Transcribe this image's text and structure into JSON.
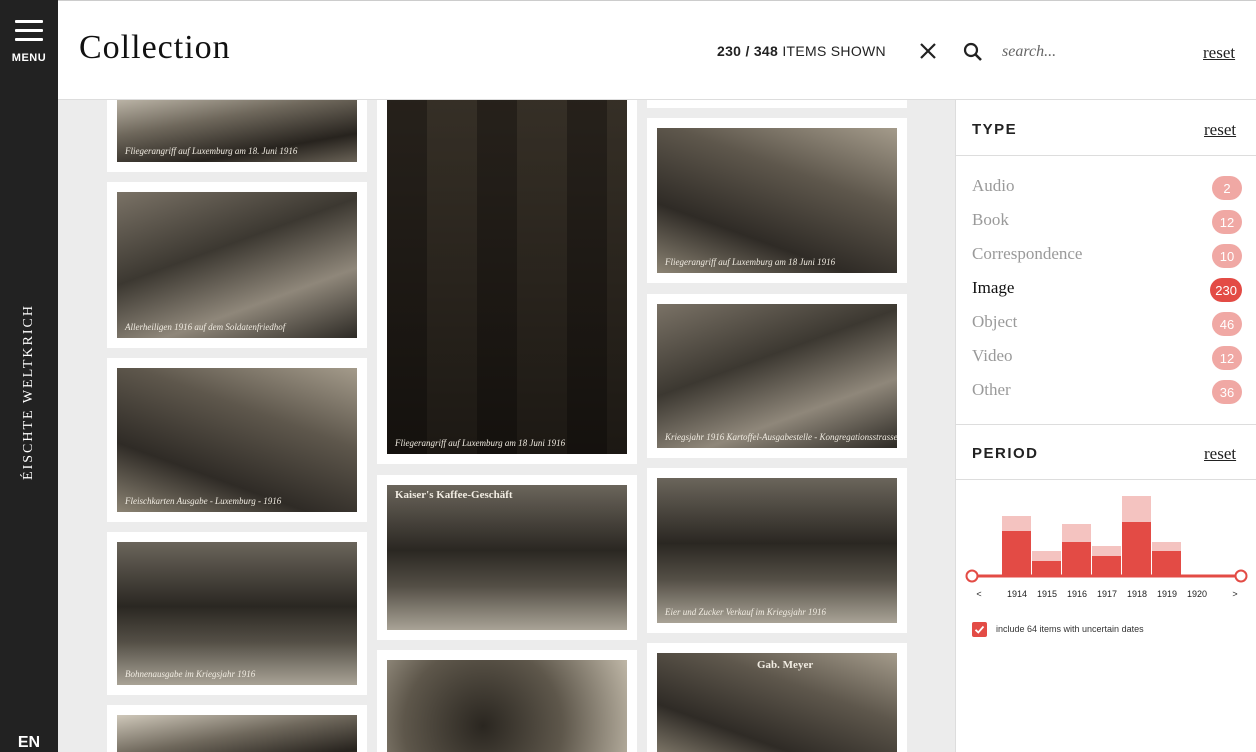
{
  "nav": {
    "menu_label": "MENU",
    "brand": "ÉISCHTE WELTKRICH",
    "language": "EN"
  },
  "header": {
    "title": "Collection",
    "shown": "230",
    "total": "348",
    "shown_suffix": "ITEMS SHOWN",
    "search_placeholder": "search...",
    "reset_label": "reset"
  },
  "gallery": {
    "captions": {
      "c1": "Fliegerangriff auf Luxemburg am 18. Juni 1916",
      "c2": "Allerheiligen 1916 auf dem Soldatenfriedhof",
      "c3": "Fleischkarten Ausgabe - Luxemburg - 1916",
      "c4": "Bohnenausgabe im Kriegsjahr 1916",
      "c5": "Fliegerangriff auf Luxemburg am 18 Juni 1916",
      "c6": "Kaiser's Kaffee-Geschäft",
      "c7": "Fliegerangriff auf Luxemburg am 18 Juni 1916",
      "c8": "Kriegsjahr 1916 Kartoffel-Ausgabestelle - Kongregationsstrasse",
      "c9": "Eier und Zucker Verkauf im Kriegsjahr 1916",
      "c10": "Gab. Meyer"
    }
  },
  "filters": {
    "type": {
      "title": "TYPE",
      "reset_label": "reset",
      "items": [
        {
          "label": "Audio",
          "count": "2",
          "active": false
        },
        {
          "label": "Book",
          "count": "12",
          "active": false
        },
        {
          "label": "Correspondence",
          "count": "10",
          "active": false
        },
        {
          "label": "Image",
          "count": "230",
          "active": true
        },
        {
          "label": "Object",
          "count": "46",
          "active": false
        },
        {
          "label": "Video",
          "count": "12",
          "active": false
        },
        {
          "label": "Other",
          "count": "36",
          "active": false
        }
      ]
    },
    "period": {
      "title": "PERIOD",
      "reset_label": "reset",
      "uncertain_label": "include 64 items with uncertain dates",
      "uncertain_checked": true
    }
  },
  "chart_data": {
    "type": "bar",
    "categories": [
      "1914",
      "1915",
      "1916",
      "1917",
      "1918",
      "1919",
      "1920"
    ],
    "series": [
      {
        "values": [
          45,
          15,
          34,
          20,
          54,
          25,
          1
        ]
      },
      {
        "values": [
          60,
          25,
          52,
          30,
          80,
          34,
          1
        ]
      }
    ],
    "range_start_label": "<",
    "range_end_label": ">",
    "colors": {
      "selected": "#e34b45",
      "total": "#f4c3c0"
    }
  }
}
